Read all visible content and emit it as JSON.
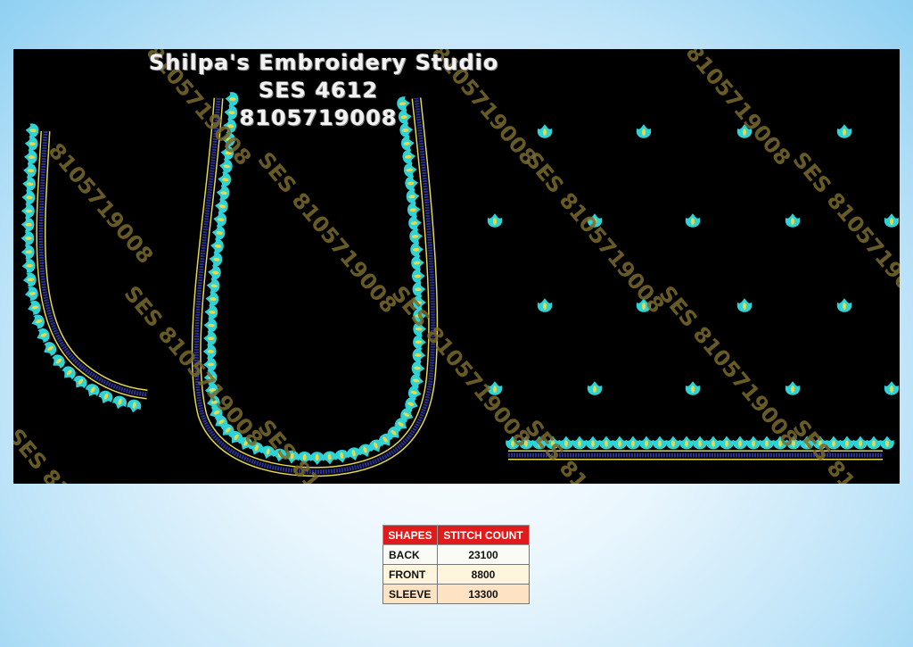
{
  "studio": {
    "name": "Shilpa's Embroidery Studio",
    "design_code": "SES  4612",
    "phone": "8105719008"
  },
  "watermark": {
    "text_full": "SES 8105719008",
    "text_partial": "8105719008"
  },
  "colors": {
    "panel_background": "#000000",
    "motif_cyan": "#2fd3d6",
    "motif_center_yellow": "#e7d94a",
    "border_yellow": "#e3d94a",
    "border_navy": "#2a2f8f",
    "watermark_gold": "#7a6a2c",
    "table_header_red": "#e01b1b"
  },
  "stitch_table": {
    "headers": [
      "SHAPES",
      "STITCH COUNT"
    ],
    "rows": [
      {
        "shape": "BACK",
        "count": "23100"
      },
      {
        "shape": "FRONT",
        "count": "8800"
      },
      {
        "shape": "SLEEVE",
        "count": "13300"
      }
    ]
  }
}
